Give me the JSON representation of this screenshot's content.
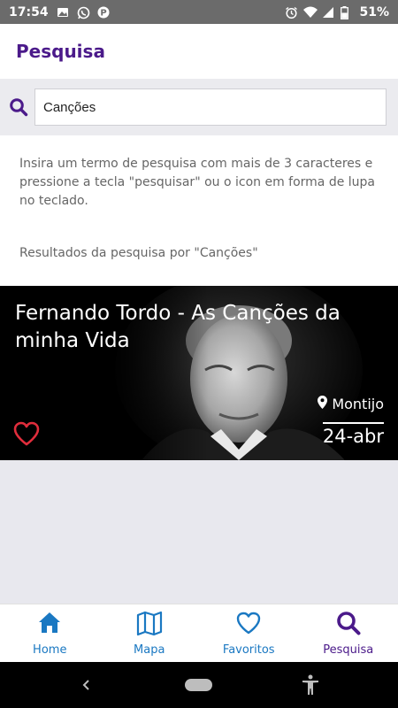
{
  "status_bar": {
    "time": "17:54",
    "battery": "51%",
    "icons_left": [
      "image-icon",
      "whatsapp-icon",
      "parking-icon"
    ],
    "icons_right": [
      "alarm-icon",
      "wifi-icon",
      "signal-icon",
      "battery-icon"
    ]
  },
  "header": {
    "title": "Pesquisa"
  },
  "search": {
    "value": "Canções"
  },
  "info": {
    "hint": "Insira um termo de pesquisa com mais de 3 caracteres e pressione a tecla \"pesquisar\" ou o icon em forma de lupa no teclado.",
    "results_label": "Resultados da pesquisa por \"Canções\""
  },
  "results": [
    {
      "title": "Fernando Tordo - As Canções da minha Vida",
      "location": "Montijo",
      "date": "24-abr",
      "favorite_icon": "heart-outline-icon"
    }
  ],
  "bottom_nav": {
    "items": [
      {
        "label": "Home",
        "icon": "home-icon"
      },
      {
        "label": "Mapa",
        "icon": "map-icon"
      },
      {
        "label": "Favoritos",
        "icon": "heart-icon"
      },
      {
        "label": "Pesquisa",
        "icon": "search-icon"
      }
    ],
    "active_index": 3
  },
  "colors": {
    "brand_purple": "#4b1a8a",
    "nav_blue": "#1a78c2",
    "heart_red": "#e02d3c",
    "status_bar_gray": "#6b6b6b"
  }
}
